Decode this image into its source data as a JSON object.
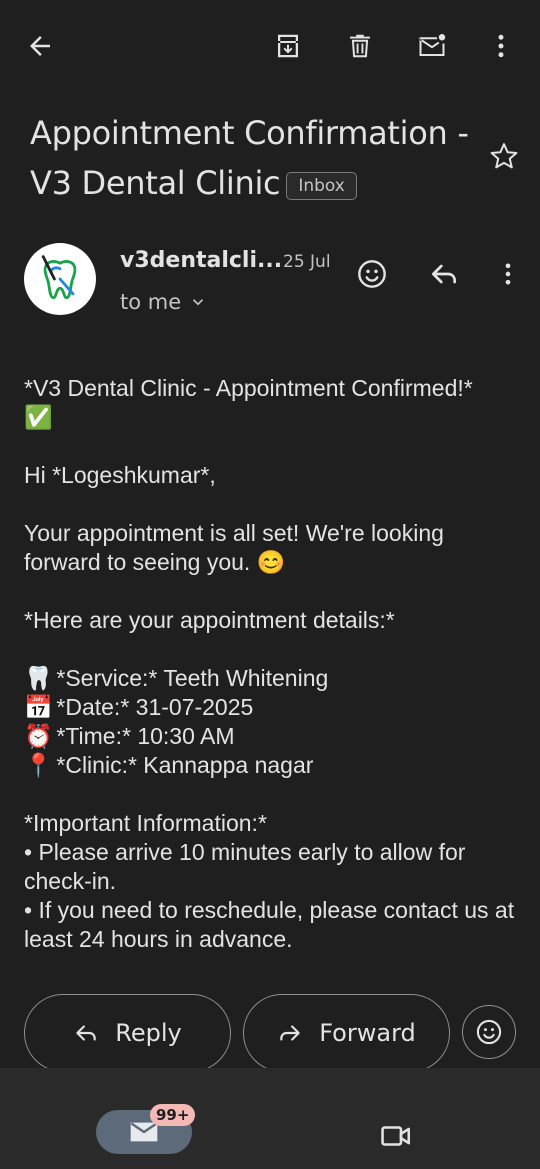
{
  "toolbar": {
    "back_icon": "arrow-left-icon",
    "archive_icon": "archive-icon",
    "delete_icon": "trash-icon",
    "mark_unread_icon": "mail-unread-icon",
    "more_icon": "more-vert-icon"
  },
  "email": {
    "subject": "Appointment Confirmation - V3 Dental Clinic",
    "label": "Inbox",
    "sender": "v3dentalcli...",
    "date": "25 Jul",
    "recipient": "to me"
  },
  "body": {
    "line1": "*V3 Dental Clinic - Appointment Confirmed!*",
    "line1_emoji": "✅",
    "greeting": "Hi *Logeshkumar*,",
    "intro": "Your appointment is all set! We're looking forward to seeing you.",
    "intro_emoji": "😊",
    "details_heading": "*Here are your appointment details:*",
    "details": [
      {
        "emoji": "🦷",
        "text": "*Service:* Teeth Whitening"
      },
      {
        "emoji": "📅",
        "text": "*Date:* 31-07-2025"
      },
      {
        "emoji": "⏰",
        "text": "*Time:* 10:30 AM"
      },
      {
        "emoji": "📍",
        "text": "*Clinic:* Kannappa nagar"
      }
    ],
    "important_heading": "*Important Information:*",
    "bullet1": "• Please arrive 10 minutes early to allow for check-in.",
    "bullet2": "• If you need to reschedule, please contact us at least 24 hours in advance."
  },
  "actions": {
    "reply_label": "Reply",
    "forward_label": "Forward"
  },
  "bottom_nav": {
    "mail_badge": "99+"
  },
  "colors": {
    "background": "#1f1f1f",
    "text": "#e3e3e3",
    "badge": "#f4b8b5"
  }
}
